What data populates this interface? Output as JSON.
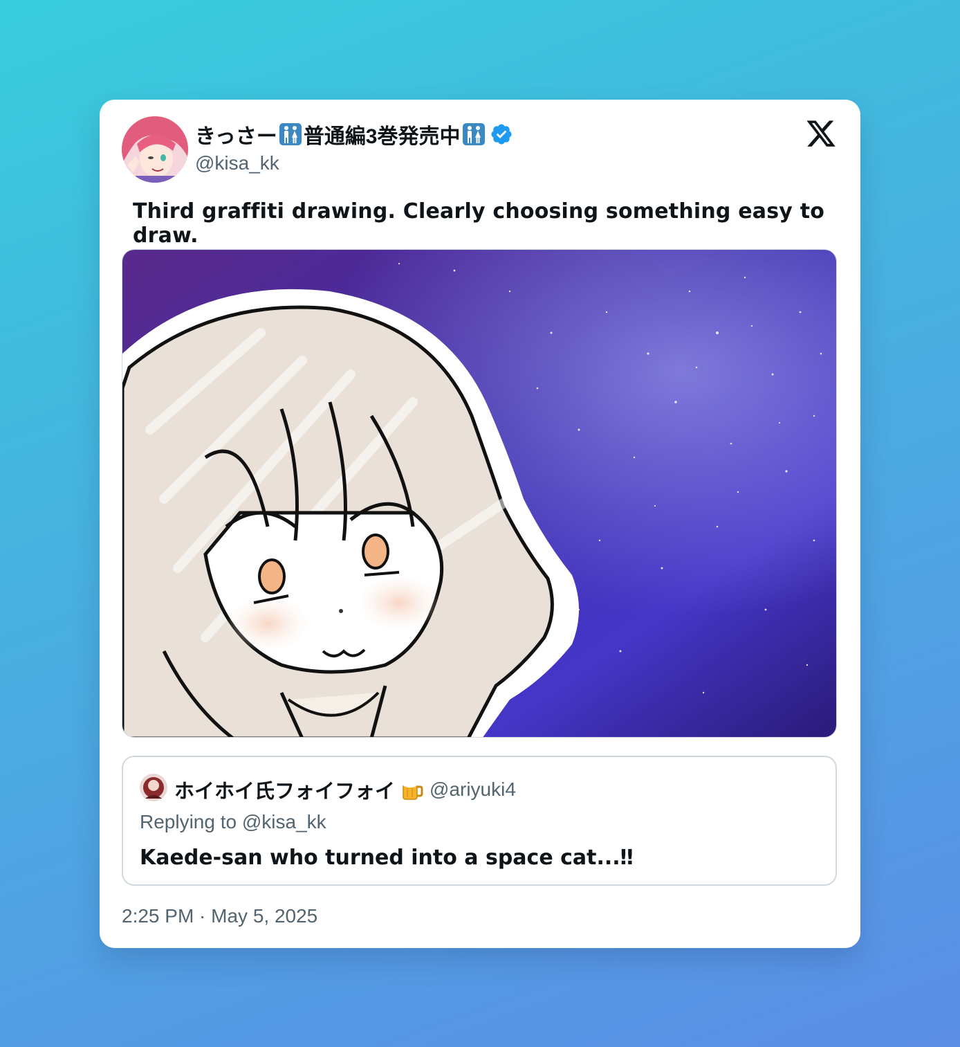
{
  "tweet": {
    "display_name": "きっさー🚻普通編3巻発売中🚻",
    "display_name_parts": [
      "きっさー",
      "普通編3巻発売中"
    ],
    "handle": "@kisa_kk",
    "verified": true,
    "text": "Third graffiti drawing. Clearly choosing something easy to draw.",
    "timestamp": "2:25 PM · May 5, 2025",
    "media_description_icon": "illustration-image"
  },
  "quote": {
    "display_name": "ホイホイ氏フォイフォイ",
    "emoji": "beer-mug-icon",
    "handle": "@ariyuki4",
    "reply_context": "Replying to @kisa_kk",
    "text": "Kaede-san who turned into a space cat...‼"
  },
  "colors": {
    "background_start": "#38cddc",
    "background_end": "#5c8ee6",
    "card": "#ffffff",
    "verified_badge": "#1d9bf0",
    "secondary_text": "#536471",
    "primary_text": "#0f1419"
  }
}
